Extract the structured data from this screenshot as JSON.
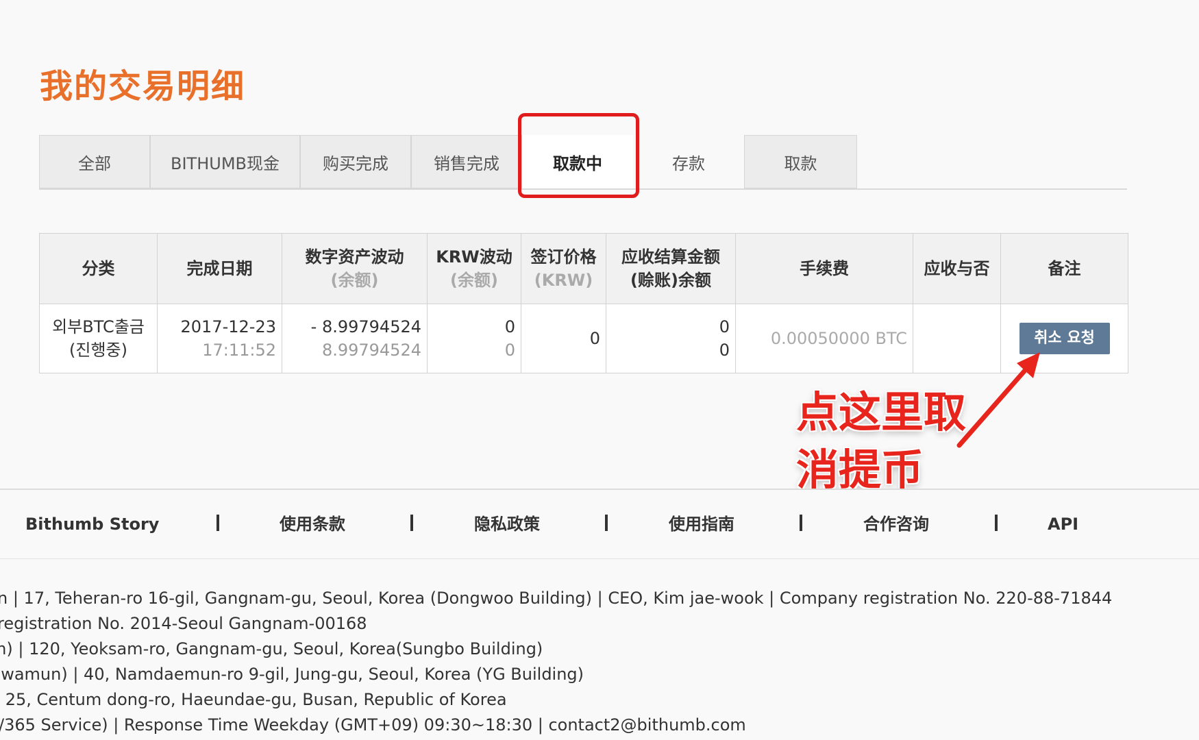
{
  "page": {
    "title": "我的交易明细"
  },
  "tabs": [
    {
      "label": "全部"
    },
    {
      "label": "BITHUMB现金"
    },
    {
      "label": "购买完成"
    },
    {
      "label": "销售完成"
    },
    {
      "label": "取款中"
    },
    {
      "label": "存款"
    },
    {
      "label": "取款"
    }
  ],
  "table": {
    "headers": {
      "category": "分类",
      "date": "完成日期",
      "asset_change": "数字资产波动",
      "asset_change_sub": "(余额)",
      "krw_change": "KRW波动",
      "krw_change_sub": "(余额)",
      "price": "签订价格",
      "price_sub": "(KRW)",
      "settle_1": "应收结算金额",
      "settle_2": "(赊账)余额",
      "fee": "手续费",
      "receivable": "应收与否",
      "remark": "备注"
    },
    "rows": [
      {
        "category_1": "외부BTC출금",
        "category_2": "(진행중)",
        "date": "2017-12-23",
        "time": "17:11:52",
        "asset_change": "- 8.99794524",
        "asset_balance": "8.99794524",
        "krw_change": "0",
        "krw_balance": "0",
        "price": "0",
        "settle_amount": "0",
        "settle_balance": "0",
        "fee": "0.00050000 BTC",
        "receivable": "",
        "remark_button": "취소 요청"
      }
    ]
  },
  "annotation": {
    "line1": "点这里取",
    "line2": "消提币"
  },
  "footer": {
    "links": [
      {
        "label": "Bithumb Story"
      },
      {
        "label": "使用条款"
      },
      {
        "label": "隐私政策"
      },
      {
        "label": "使用指南"
      },
      {
        "label": "合作咨询"
      },
      {
        "label": "API"
      }
    ],
    "company_lines": [
      "n | 17, Teheran-ro 16-gil, Gangnam-gu, Seoul, Korea (Dongwoo Building) | CEO, Kim jae-wook | Company registration No. 220-88-71844",
      "registration No. 2014-Seoul Gangnam-00168",
      "m) | 120, Yeoksam-ro, Gangnam-gu, Seoul, Korea(Sungbo Building)",
      "hwamun) | 40, Namdaemun-ro 9-gil, Jung-gu, Seoul, Korea (YG Building)",
      " | 25, Centum dong-ro, Haeundae-gu, Busan, Republic of Korea",
      "/365 Service) | Response Time Weekday (GMT+09) 09:30~18:30 | contact2@bithumb.com"
    ]
  },
  "colors": {
    "title": "#e8702a",
    "highlight": "#e11c1c",
    "button": "#5e7a96",
    "annotation": "#e8251c"
  }
}
